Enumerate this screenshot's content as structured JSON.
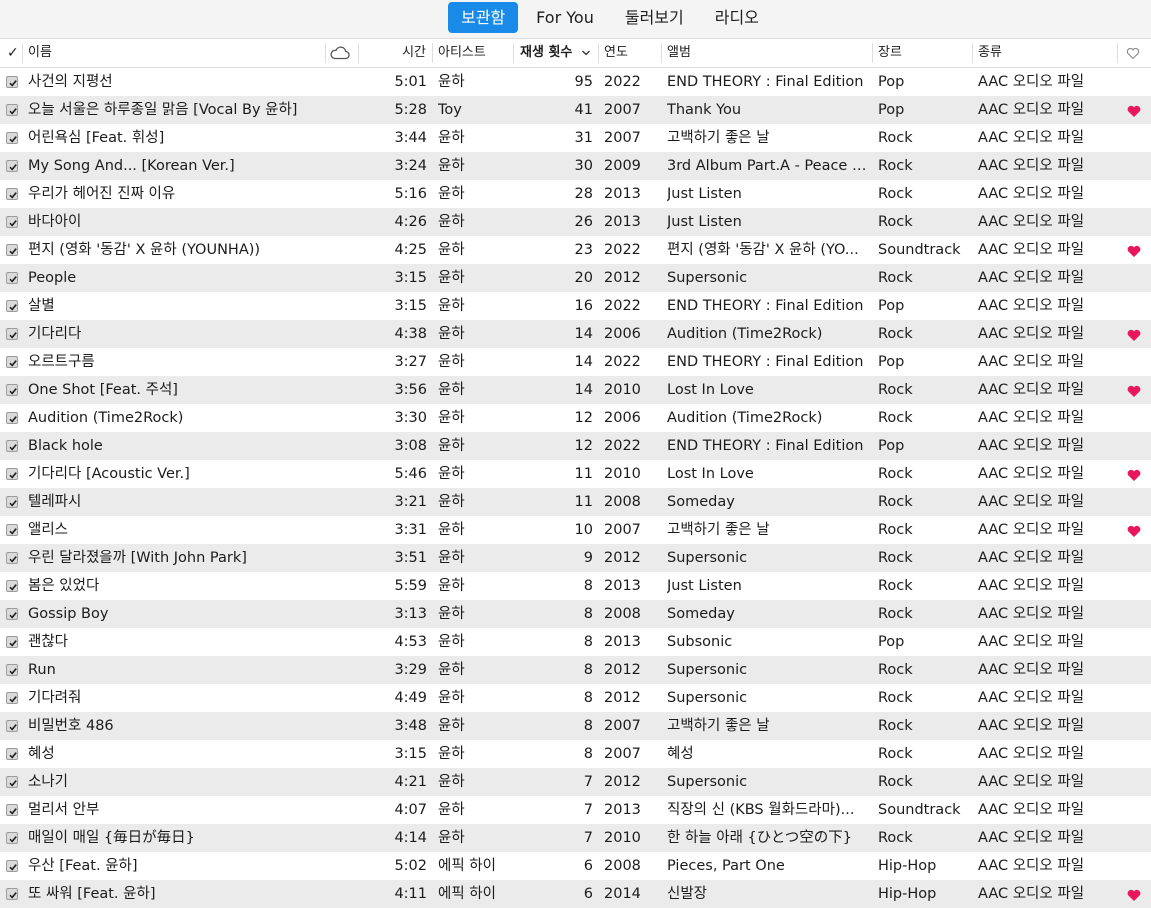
{
  "tabs": [
    {
      "label": "보관함",
      "active": true
    },
    {
      "label": "For You",
      "active": false
    },
    {
      "label": "둘러보기",
      "active": false
    },
    {
      "label": "라디오",
      "active": false
    }
  ],
  "columns": {
    "check": "✓",
    "name": "이름",
    "cloud": "cloud-icon",
    "time": "시간",
    "artist": "아티스트",
    "plays": "재생 횟수",
    "year": "연도",
    "album": "앨범",
    "genre": "장르",
    "kind": "종류",
    "love": "heart-outline-icon"
  },
  "sort": {
    "column": "plays",
    "direction": "descending"
  },
  "colors": {
    "accent": "#1a8ae8",
    "heart": "#e8175d",
    "row_alt": "#ebebeb"
  },
  "rows": [
    {
      "name": "사건의 지평선",
      "time": "5:01",
      "artist": "윤하",
      "plays": "95",
      "year": "2022",
      "album": "END THEORY : Final Edition",
      "genre": "Pop",
      "kind": "AAC 오디오 파일",
      "loved": false
    },
    {
      "name": "오늘 서울은 하루종일 맑음 [Vocal By 윤하]",
      "time": "5:28",
      "artist": "Toy",
      "plays": "41",
      "year": "2007",
      "album": "Thank You",
      "genre": "Pop",
      "kind": "AAC 오디오 파일",
      "loved": true
    },
    {
      "name": "어린욕심 [Feat. 휘성]",
      "time": "3:44",
      "artist": "윤하",
      "plays": "31",
      "year": "2007",
      "album": "고백하기 좋은 날",
      "genre": "Rock",
      "kind": "AAC 오디오 파일",
      "loved": false
    },
    {
      "name": "My Song And... [Korean Ver.]",
      "time": "3:24",
      "artist": "윤하",
      "plays": "30",
      "year": "2009",
      "album": "3rd Album Part.A - Peace Lo...",
      "genre": "Rock",
      "kind": "AAC 오디오 파일",
      "loved": false
    },
    {
      "name": "우리가 헤어진 진짜 이유",
      "time": "5:16",
      "artist": "윤하",
      "plays": "28",
      "year": "2013",
      "album": "Just Listen",
      "genre": "Rock",
      "kind": "AAC 오디오 파일",
      "loved": false
    },
    {
      "name": "바다아이",
      "time": "4:26",
      "artist": "윤하",
      "plays": "26",
      "year": "2013",
      "album": "Just Listen",
      "genre": "Rock",
      "kind": "AAC 오디오 파일",
      "loved": false
    },
    {
      "name": "편지 (영화 '동감' X 윤하 (YOUNHA))",
      "time": "4:25",
      "artist": "윤하",
      "plays": "23",
      "year": "2022",
      "album": "편지 (영화 '동감' X 윤하 (YO...",
      "genre": "Soundtrack",
      "kind": "AAC 오디오 파일",
      "loved": true
    },
    {
      "name": "People",
      "time": "3:15",
      "artist": "윤하",
      "plays": "20",
      "year": "2012",
      "album": "Supersonic",
      "genre": "Rock",
      "kind": "AAC 오디오 파일",
      "loved": false
    },
    {
      "name": "살별",
      "time": "3:15",
      "artist": "윤하",
      "plays": "16",
      "year": "2022",
      "album": "END THEORY : Final Edition",
      "genre": "Pop",
      "kind": "AAC 오디오 파일",
      "loved": false
    },
    {
      "name": "기다리다",
      "time": "4:38",
      "artist": "윤하",
      "plays": "14",
      "year": "2006",
      "album": "Audition (Time2Rock)",
      "genre": "Rock",
      "kind": "AAC 오디오 파일",
      "loved": true
    },
    {
      "name": "오르트구름",
      "time": "3:27",
      "artist": "윤하",
      "plays": "14",
      "year": "2022",
      "album": "END THEORY : Final Edition",
      "genre": "Pop",
      "kind": "AAC 오디오 파일",
      "loved": false
    },
    {
      "name": "One Shot [Feat. 주석]",
      "time": "3:56",
      "artist": "윤하",
      "plays": "14",
      "year": "2010",
      "album": "Lost In Love",
      "genre": "Rock",
      "kind": "AAC 오디오 파일",
      "loved": true
    },
    {
      "name": "Audition (Time2Rock)",
      "time": "3:30",
      "artist": "윤하",
      "plays": "12",
      "year": "2006",
      "album": "Audition (Time2Rock)",
      "genre": "Rock",
      "kind": "AAC 오디오 파일",
      "loved": false
    },
    {
      "name": "Black hole",
      "time": "3:08",
      "artist": "윤하",
      "plays": "12",
      "year": "2022",
      "album": "END THEORY : Final Edition",
      "genre": "Pop",
      "kind": "AAC 오디오 파일",
      "loved": false
    },
    {
      "name": "기다리다 [Acoustic Ver.]",
      "time": "5:46",
      "artist": "윤하",
      "plays": "11",
      "year": "2010",
      "album": "Lost In Love",
      "genre": "Rock",
      "kind": "AAC 오디오 파일",
      "loved": true
    },
    {
      "name": "텔레파시",
      "time": "3:21",
      "artist": "윤하",
      "plays": "11",
      "year": "2008",
      "album": "Someday",
      "genre": "Rock",
      "kind": "AAC 오디오 파일",
      "loved": false
    },
    {
      "name": "앨리스",
      "time": "3:31",
      "artist": "윤하",
      "plays": "10",
      "year": "2007",
      "album": "고백하기 좋은 날",
      "genre": "Rock",
      "kind": "AAC 오디오 파일",
      "loved": true
    },
    {
      "name": "우린 달라졌을까 [With John Park]",
      "time": "3:51",
      "artist": "윤하",
      "plays": "9",
      "year": "2012",
      "album": "Supersonic",
      "genre": "Rock",
      "kind": "AAC 오디오 파일",
      "loved": false
    },
    {
      "name": "봄은 있었다",
      "time": "5:59",
      "artist": "윤하",
      "plays": "8",
      "year": "2013",
      "album": "Just Listen",
      "genre": "Rock",
      "kind": "AAC 오디오 파일",
      "loved": false
    },
    {
      "name": "Gossip Boy",
      "time": "3:13",
      "artist": "윤하",
      "plays": "8",
      "year": "2008",
      "album": "Someday",
      "genre": "Rock",
      "kind": "AAC 오디오 파일",
      "loved": false
    },
    {
      "name": "괜찮다",
      "time": "4:53",
      "artist": "윤하",
      "plays": "8",
      "year": "2013",
      "album": "Subsonic",
      "genre": "Pop",
      "kind": "AAC 오디오 파일",
      "loved": false
    },
    {
      "name": "Run",
      "time": "3:29",
      "artist": "윤하",
      "plays": "8",
      "year": "2012",
      "album": "Supersonic",
      "genre": "Rock",
      "kind": "AAC 오디오 파일",
      "loved": false
    },
    {
      "name": "기다려줘",
      "time": "4:49",
      "artist": "윤하",
      "plays": "8",
      "year": "2012",
      "album": "Supersonic",
      "genre": "Rock",
      "kind": "AAC 오디오 파일",
      "loved": false
    },
    {
      "name": "비밀번호 486",
      "time": "3:48",
      "artist": "윤하",
      "plays": "8",
      "year": "2007",
      "album": "고백하기 좋은 날",
      "genre": "Rock",
      "kind": "AAC 오디오 파일",
      "loved": false
    },
    {
      "name": "혜성",
      "time": "3:15",
      "artist": "윤하",
      "plays": "8",
      "year": "2007",
      "album": "혜성",
      "genre": "Rock",
      "kind": "AAC 오디오 파일",
      "loved": false
    },
    {
      "name": "소나기",
      "time": "4:21",
      "artist": "윤하",
      "plays": "7",
      "year": "2012",
      "album": "Supersonic",
      "genre": "Rock",
      "kind": "AAC 오디오 파일",
      "loved": false
    },
    {
      "name": "멀리서 안부",
      "time": "4:07",
      "artist": "윤하",
      "plays": "7",
      "year": "2013",
      "album": "직장의 신 (KBS 월화드라마)...",
      "genre": "Soundtrack",
      "kind": "AAC 오디오 파일",
      "loved": false
    },
    {
      "name": "매일이 매일 {毎日が毎日}",
      "time": "4:14",
      "artist": "윤하",
      "plays": "7",
      "year": "2010",
      "album": "한 하늘 아래 {ひとつ空の下}",
      "genre": "Rock",
      "kind": "AAC 오디오 파일",
      "loved": false
    },
    {
      "name": "우산 [Feat. 윤하]",
      "time": "5:02",
      "artist": "에픽 하이",
      "plays": "6",
      "year": "2008",
      "album": "Pieces, Part One",
      "genre": "Hip-Hop",
      "kind": "AAC 오디오 파일",
      "loved": false
    },
    {
      "name": "또 싸워 [Feat. 윤하]",
      "time": "4:11",
      "artist": "에픽 하이",
      "plays": "6",
      "year": "2014",
      "album": "신발장",
      "genre": "Hip-Hop",
      "kind": "AAC 오디오 파일",
      "loved": true
    }
  ]
}
